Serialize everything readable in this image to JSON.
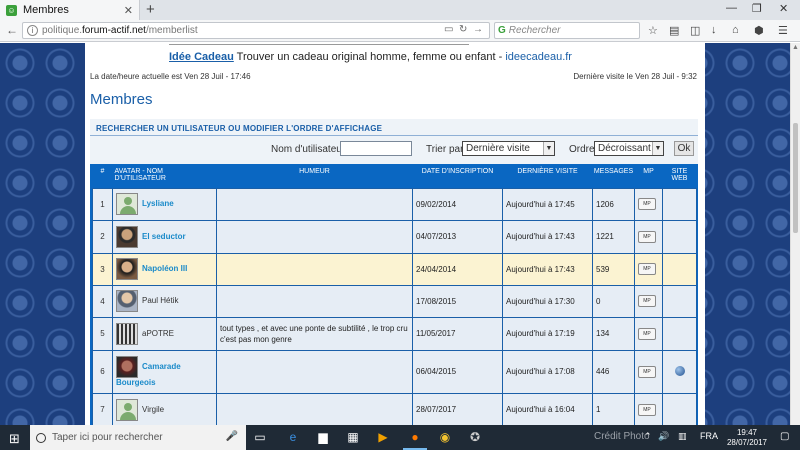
{
  "browser": {
    "tab_title": "Membres",
    "url_host_prefix": "politique.",
    "url_host_main": "forum-actif.net",
    "url_path": "/memberlist",
    "search_placeholder": "Rechercher"
  },
  "ad": {
    "brand": "Idée Cadeau",
    "text": "Trouver un cadeau original homme, femme ou enfant -",
    "domain": "ideecadeau.fr"
  },
  "header": {
    "datetime": "La date/heure actuelle est Ven 28 Juil - 17:46",
    "last_visit": "Dernière visite le Ven 28 Juil - 9:32",
    "title": "Membres"
  },
  "search": {
    "heading": "RECHERCHER UN UTILISATEUR OU MODIFIER L'ORDRE D'AFFICHAGE",
    "username_label": "Nom d'utilisateur",
    "username_value": "",
    "sort_label": "Trier par",
    "sort_value": "Dernière visite",
    "order_label": "Ordre",
    "order_value": "Décroissant",
    "ok_label": "Ok"
  },
  "table": {
    "columns": {
      "num": "#",
      "avatar_line1": "AVATAR - NOM",
      "avatar_line2": "D'UTILISATEUR",
      "mood": "HUMEUR",
      "joined": "DATE D'INSCRIPTION",
      "last": "DERNIÈRE VISITE",
      "messages": "MESSAGES",
      "mp": "MP",
      "site1": "SITE",
      "site2": "WEB"
    },
    "mp_icon_text": "MP",
    "rows": [
      {
        "num": "1",
        "name": "Lysliane",
        "mood": "",
        "joined": "09/02/2014",
        "last": "Aujourd'hui à 17:45",
        "messages": "1206"
      },
      {
        "num": "2",
        "name": "El seductor",
        "mood": "",
        "joined": "04/07/2013",
        "last": "Aujourd'hui à 17:43",
        "messages": "1221"
      },
      {
        "num": "3",
        "name": "Napoléon III",
        "mood": "",
        "joined": "24/04/2014",
        "last": "Aujourd'hui à 17:43",
        "messages": "539"
      },
      {
        "num": "4",
        "name": "Paul Hétik",
        "mood": "",
        "joined": "17/08/2015",
        "last": "Aujourd'hui à 17:30",
        "messages": "0"
      },
      {
        "num": "5",
        "name": "aPOTRE",
        "mood": "tout types , et avec une ponte de subtilité , le trop cru c'est pas mon genre",
        "joined": "11/05/2017",
        "last": "Aujourd'hui à 17:19",
        "messages": "134"
      },
      {
        "num": "6",
        "name_line1": "Camarade",
        "name_line2": "Bourgeois",
        "mood": "",
        "joined": "06/04/2015",
        "last": "Aujourd'hui à 17:08",
        "messages": "446"
      },
      {
        "num": "7",
        "name": "Virgile",
        "mood": "",
        "joined": "28/07/2017",
        "last": "Aujourd'hui à 16:04",
        "messages": "1"
      }
    ]
  },
  "taskbar": {
    "search_placeholder": "Taper ici pour rechercher",
    "watermark": "Crédit Photo",
    "lang": "FRA",
    "time": "19:47",
    "date": "28/07/2017"
  }
}
